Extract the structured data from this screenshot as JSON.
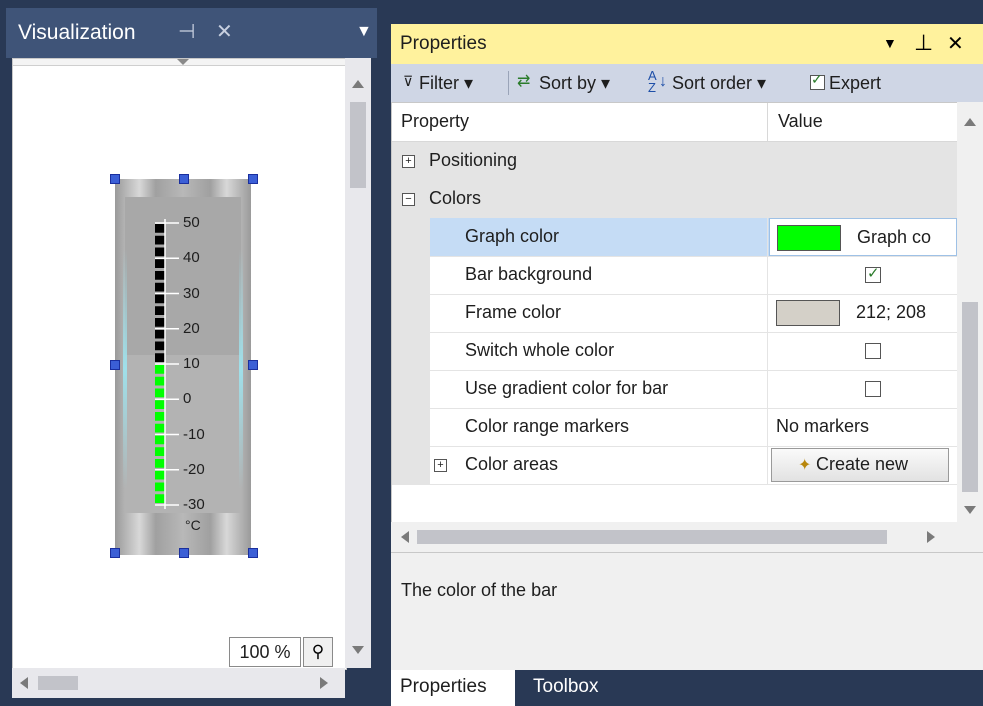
{
  "visualization": {
    "title": "Visualization",
    "pin_glyph": "⊣",
    "close_glyph": "✕",
    "menu_glyph": "▾",
    "zoom": "100 %",
    "thermometer": {
      "scale_labels": [
        "50",
        "40",
        "30",
        "20",
        "10",
        "0",
        "-10",
        "-20",
        "-30"
      ],
      "unit": "°C",
      "value": 10,
      "min": -30,
      "max": 50
    }
  },
  "properties": {
    "title": "Properties",
    "toolbar": {
      "filter_label": "Filter ▾",
      "sort_by_label": "Sort by ▾",
      "sort_order_label": "Sort order ▾",
      "expert_label": "Expert",
      "expert_checked": true
    },
    "grid": {
      "header_property": "Property",
      "header_value": "Value",
      "rows": [
        {
          "kind": "category",
          "expander": "+",
          "label": "Positioning",
          "value": ""
        },
        {
          "kind": "category",
          "expander": "−",
          "label": "Colors",
          "value": ""
        },
        {
          "kind": "color",
          "label": "Graph color",
          "value": "Graph co",
          "swatch": "#00ff00",
          "selected": true
        },
        {
          "kind": "checkbox",
          "label": "Bar background",
          "checked": true
        },
        {
          "kind": "color",
          "label": "Frame color",
          "value": "212; 208",
          "swatch": "#d4d0c8"
        },
        {
          "kind": "checkbox",
          "label": "Switch whole color",
          "checked": false
        },
        {
          "kind": "checkbox",
          "label": "Use gradient color for bar",
          "checked": false
        },
        {
          "kind": "text",
          "label": "Color range markers",
          "value": "No markers"
        },
        {
          "kind": "button",
          "expander": "+",
          "label": "Color areas",
          "value": "Create new"
        }
      ]
    },
    "description": "The color of the bar",
    "tabs": [
      "Properties",
      "Toolbox"
    ],
    "active_tab": "Properties"
  },
  "colors": {
    "window_bg": "#293955",
    "title_active": "#fff29d",
    "title_inactive": "#3f5478",
    "selection": "#c5dcf5",
    "graph": "#00ff00"
  }
}
